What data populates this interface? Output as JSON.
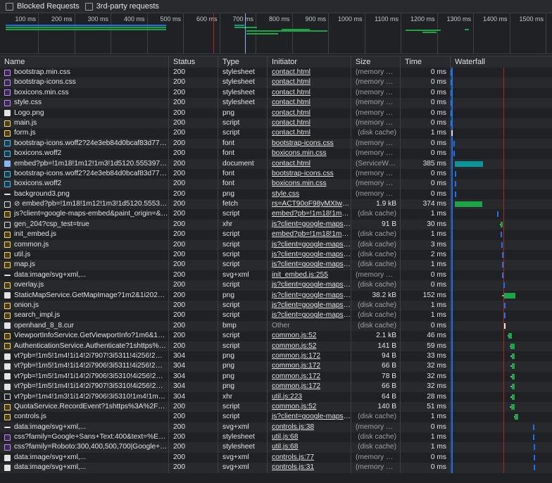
{
  "toolbar": {
    "blocked_requests": "Blocked Requests",
    "third_party": "3rd-party requests"
  },
  "overview": {
    "ticks": [
      "100 ms",
      "200 ms",
      "300 ms",
      "400 ms",
      "500 ms",
      "600 ms",
      "700 ms",
      "800 ms",
      "900 ms",
      "1000 ms",
      "1100 ms",
      "1200 ms",
      "1300 ms",
      "1400 ms",
      "1500 ms"
    ]
  },
  "columns": {
    "name": "Name",
    "status": "Status",
    "type": "Type",
    "initiator": "Initiator",
    "size": "Size",
    "time": "Time",
    "waterfall": "Waterfall"
  },
  "colors": {
    "bg": "#202124",
    "alt_row": "#28292c",
    "teal": "#0b9797",
    "green": "#1ea446",
    "blue_line": "#1a73e8",
    "red_line": "#b3261e"
  },
  "rows": [
    {
      "icon": "css-file-icon",
      "kind": "css",
      "name": "bootstrap.min.css",
      "status": "200",
      "type": "stylesheet",
      "initiator": "contact.html",
      "link": true,
      "size": "(memory cac...",
      "size_muted": true,
      "time": "0 ms",
      "wf_start": 0.3,
      "wf_len": 0.5,
      "wf_color": "#1a73e8",
      "wf_lead": 0
    },
    {
      "icon": "css-file-icon",
      "kind": "css",
      "name": "bootstrap-icons.css",
      "status": "200",
      "type": "stylesheet",
      "initiator": "contact.html",
      "link": true,
      "size": "(memory cac...",
      "size_muted": true,
      "time": "0 ms",
      "wf_start": 0.3,
      "wf_len": 0.5,
      "wf_color": "#1a73e8",
      "wf_lead": 0
    },
    {
      "icon": "css-file-icon",
      "kind": "css",
      "name": "boxicons.min.css",
      "status": "200",
      "type": "stylesheet",
      "initiator": "contact.html",
      "link": true,
      "size": "(memory cac...",
      "size_muted": true,
      "time": "0 ms",
      "wf_start": 0.3,
      "wf_len": 0.5,
      "wf_color": "#1a73e8",
      "wf_lead": 0
    },
    {
      "icon": "css-file-icon",
      "kind": "css",
      "name": "style.css",
      "status": "200",
      "type": "stylesheet",
      "initiator": "contact.html",
      "link": true,
      "size": "(memory cac...",
      "size_muted": true,
      "time": "0 ms",
      "wf_start": 0.3,
      "wf_len": 0.5,
      "wf_color": "#1a73e8",
      "wf_lead": 0
    },
    {
      "icon": "image-file-icon",
      "kind": "img",
      "name": "Logo.png",
      "status": "200",
      "type": "png",
      "initiator": "contact.html",
      "link": true,
      "size": "(memory cac...",
      "size_muted": true,
      "time": "0 ms",
      "wf_start": 0.3,
      "wf_len": 0.5,
      "wf_color": "#1a73e8",
      "wf_lead": 0
    },
    {
      "icon": "js-file-icon",
      "kind": "js",
      "name": "main.js",
      "status": "200",
      "type": "script",
      "initiator": "contact.html",
      "link": true,
      "size": "(memory cac...",
      "size_muted": true,
      "time": "0 ms",
      "wf_start": 0.3,
      "wf_len": 0.5,
      "wf_color": "#1a73e8",
      "wf_lead": 0
    },
    {
      "icon": "js-file-icon",
      "kind": "js",
      "name": "form.js",
      "status": "200",
      "type": "script",
      "initiator": "contact.html",
      "link": true,
      "size": "(disk cache)",
      "size_muted": true,
      "time": "1 ms",
      "wf_start": 0.5,
      "wf_len": 1.5,
      "wf_color": "#e3e3e3",
      "wf_lead": 0
    },
    {
      "icon": "font-file-icon",
      "kind": "font",
      "name": "bootstrap-icons.woff2?24e3eb84d0bcaf83d77f90...",
      "status": "200",
      "type": "font",
      "initiator": "bootstrap-icons.css",
      "link": true,
      "size": "(memory cac...",
      "size_muted": true,
      "time": "0 ms",
      "wf_start": 2.5,
      "wf_len": 0.5,
      "wf_color": "#1a73e8",
      "wf_lead": 0
    },
    {
      "icon": "font-file-icon",
      "kind": "font",
      "name": "boxicons.woff2",
      "status": "200",
      "type": "font",
      "initiator": "boxicons.min.css",
      "link": true,
      "size": "(memory cac...",
      "size_muted": true,
      "time": "0 ms",
      "wf_start": 2.5,
      "wf_len": 0.5,
      "wf_color": "#1a73e8",
      "wf_lead": 0
    },
    {
      "icon": "document-file-icon",
      "kind": "doc",
      "name": "embed?pb=!1m18!1m12!1m3!1d5120.555397400...",
      "status": "200",
      "type": "document",
      "initiator": "contact.html",
      "link": true,
      "size": "(ServiceWorker)",
      "size_muted": true,
      "time": "385 ms",
      "wf_start": 4.5,
      "wf_len": 27.5,
      "wf_color": "#0b9797",
      "wf_lead": 0
    },
    {
      "icon": "font-file-icon",
      "kind": "font",
      "name": "bootstrap-icons.woff2?24e3eb84d0bcaf83d77f90...",
      "status": "200",
      "type": "font",
      "initiator": "bootstrap-icons.css",
      "link": true,
      "size": "(memory cac...",
      "size_muted": true,
      "time": "0 ms",
      "wf_start": 4.0,
      "wf_len": 0.5,
      "wf_color": "#1a73e8",
      "wf_lead": 0
    },
    {
      "icon": "font-file-icon",
      "kind": "font",
      "name": "boxicons.woff2",
      "status": "200",
      "type": "font",
      "initiator": "boxicons.min.css",
      "link": true,
      "size": "(memory cac...",
      "size_muted": true,
      "time": "0 ms",
      "wf_start": 4.0,
      "wf_len": 0.5,
      "wf_color": "#1a73e8",
      "wf_lead": 0
    },
    {
      "icon": "image-file-icon",
      "kind": "dash",
      "name": "background3.png",
      "status": "200",
      "type": "png",
      "initiator": "style.css",
      "link": true,
      "size": "(memory cac...",
      "size_muted": true,
      "time": "0 ms",
      "wf_start": 4.0,
      "wf_len": 0.5,
      "wf_color": "#1a73e8",
      "wf_lead": 0
    },
    {
      "icon": "fetch-file-icon",
      "kind": "xhr",
      "name": "⊘ embed?pb=!1m18!1m12!1m3!1d5120.5553974...",
      "status": "200",
      "type": "fetch",
      "initiator": "rs=ACT90oF98yMXIwkm...",
      "link": true,
      "size": "1.9 kB",
      "size_muted": false,
      "time": "374 ms",
      "wf_start": 4.5,
      "wf_len": 26.8,
      "wf_color": "#1ea446",
      "wf_lead": 0
    },
    {
      "icon": "js-file-icon",
      "kind": "js",
      "name": "js?client=google-maps-embed&paint_origin=&li...",
      "status": "200",
      "type": "script",
      "initiator": "embed?pb=!1m18!1m12...",
      "link": true,
      "size": "(disk cache)",
      "size_muted": true,
      "time": "1 ms",
      "wf_start": 45.5,
      "wf_len": 1.0,
      "wf_color": "#1a73e8",
      "wf_lead": 0
    },
    {
      "icon": "xhr-file-icon",
      "kind": "xhr",
      "name": "gen_204?csp_test=true",
      "status": "200",
      "type": "xhr",
      "initiator": "js?client=google-maps-e...",
      "link": true,
      "size": "91 B",
      "size_muted": false,
      "time": "30 ms",
      "wf_start": 49.5,
      "wf_len": 2.0,
      "wf_color": "#1ea446",
      "wf_lead": 1.0
    },
    {
      "icon": "js-file-icon",
      "kind": "js",
      "name": "init_embed.js",
      "status": "200",
      "type": "script",
      "initiator": "embed?pb=!1m18!1m12...",
      "link": true,
      "size": "(disk cache)",
      "size_muted": true,
      "time": "1 ms",
      "wf_start": 49.5,
      "wf_len": 1.0,
      "wf_color": "#1a73e8",
      "wf_lead": 0
    },
    {
      "icon": "js-file-icon",
      "kind": "js",
      "name": "common.js",
      "status": "200",
      "type": "script",
      "initiator": "js?client=google-maps-e...",
      "link": true,
      "size": "(disk cache)",
      "size_muted": true,
      "time": "3 ms",
      "wf_start": 50.0,
      "wf_len": 1.0,
      "wf_color": "#1a73e8",
      "wf_lead": 0
    },
    {
      "icon": "js-file-icon",
      "kind": "js",
      "name": "util.js",
      "status": "200",
      "type": "script",
      "initiator": "js?client=google-maps-e...",
      "link": true,
      "size": "(disk cache)",
      "size_muted": true,
      "time": "2 ms",
      "wf_start": 50.5,
      "wf_len": 1.0,
      "wf_color": "#1a73e8",
      "wf_lead": 0
    },
    {
      "icon": "js-file-icon",
      "kind": "js",
      "name": "map.js",
      "status": "200",
      "type": "script",
      "initiator": "js?client=google-maps-e...",
      "link": true,
      "size": "(disk cache)",
      "size_muted": true,
      "time": "1 ms",
      "wf_start": 51.0,
      "wf_len": 1.0,
      "wf_color": "#1a73e8",
      "wf_lead": 0
    },
    {
      "icon": "svg-image-icon",
      "kind": "dash",
      "name": "data:image/svg+xml,...",
      "status": "200",
      "type": "svg+xml",
      "initiator": "init_embed.js:255",
      "link": true,
      "size": "(memory cac...",
      "size_muted": true,
      "time": "0 ms",
      "wf_start": 51.0,
      "wf_len": 0.5,
      "wf_color": "#1a73e8",
      "wf_lead": 0
    },
    {
      "icon": "js-file-icon",
      "kind": "js",
      "name": "overlay.js",
      "status": "200",
      "type": "script",
      "initiator": "js?client=google-maps-e...",
      "link": true,
      "size": "(disk cache)",
      "size_muted": true,
      "time": "0 ms",
      "wf_start": 52.0,
      "wf_len": 0.8,
      "wf_color": "#1a73e8",
      "wf_lead": 0
    },
    {
      "icon": "image-file-icon",
      "kind": "img",
      "name": "StaticMapService.GetMapImage?1m2&1i2024011...",
      "status": "200",
      "type": "png",
      "initiator": "js?client=google-maps-e...",
      "link": true,
      "size": "38.2 kB",
      "size_muted": false,
      "time": "152 ms",
      "wf_start": 53.0,
      "wf_len": 11.0,
      "wf_color": "#1ea446",
      "wf_lead": 2.0
    },
    {
      "icon": "js-file-icon",
      "kind": "js",
      "name": "onion.js",
      "status": "200",
      "type": "script",
      "initiator": "js?client=google-maps-e...",
      "link": true,
      "size": "(disk cache)",
      "size_muted": true,
      "time": "1 ms",
      "wf_start": 52.5,
      "wf_len": 0.8,
      "wf_color": "#1a73e8",
      "wf_lead": 0
    },
    {
      "icon": "js-file-icon",
      "kind": "js",
      "name": "search_impl.js",
      "status": "200",
      "type": "script",
      "initiator": "js?client=google-maps-e...",
      "link": true,
      "size": "(disk cache)",
      "size_muted": true,
      "time": "1 ms",
      "wf_start": 52.5,
      "wf_len": 0.8,
      "wf_color": "#1a73e8",
      "wf_lead": 0
    },
    {
      "icon": "image-file-icon",
      "kind": "img",
      "name": "openhand_8_8.cur",
      "status": "200",
      "type": "bmp",
      "initiator": "Other",
      "link": false,
      "size": "(disk cache)",
      "size_muted": true,
      "time": "0 ms",
      "wf_start": 53.0,
      "wf_len": 1.0,
      "wf_color": "#e3e3e3",
      "wf_lead": 0
    },
    {
      "icon": "js-file-icon",
      "kind": "js",
      "name": "ViewportInfoService.GetViewportInfo?1m6&1m2...",
      "status": "200",
      "type": "script",
      "initiator": "common.js:52",
      "link": true,
      "size": "2.1 kB",
      "size_muted": false,
      "time": "46 ms",
      "wf_start": 57.0,
      "wf_len": 3.5,
      "wf_color": "#1ea446",
      "wf_lead": 1.0
    },
    {
      "icon": "js-file-icon",
      "kind": "js",
      "name": "AuthenticationService.Authenticate?1shttps%3A%...",
      "status": "200",
      "type": "script",
      "initiator": "common.js:52",
      "link": true,
      "size": "141 B",
      "size_muted": false,
      "time": "59 ms",
      "wf_start": 59.0,
      "wf_len": 4.0,
      "wf_color": "#1ea446",
      "wf_lead": 1.0
    },
    {
      "icon": "image-file-icon",
      "kind": "img",
      "name": "vt?pb=!1m5!1m4!1i14!2i7907!3i5311!4i256!2m3!1...",
      "status": "304",
      "type": "png",
      "initiator": "common.js:172",
      "link": true,
      "size": "94 B",
      "size_muted": false,
      "time": "33 ms",
      "wf_start": 60.5,
      "wf_len": 3.0,
      "wf_color": "#1ea446",
      "wf_lead": 1.5
    },
    {
      "icon": "image-file-icon",
      "kind": "img",
      "name": "vt?pb=!1m5!1m4!1i14!2i7906!3i5311!4i256!2m3!1...",
      "status": "304",
      "type": "png",
      "initiator": "common.js:172",
      "link": true,
      "size": "66 B",
      "size_muted": false,
      "time": "32 ms",
      "wf_start": 60.5,
      "wf_len": 3.0,
      "wf_color": "#1ea446",
      "wf_lead": 1.5
    },
    {
      "icon": "image-file-icon",
      "kind": "img",
      "name": "vt?pb=!1m5!1m4!1i14!2i7906!3i5310!4i256!2m3!1...",
      "status": "304",
      "type": "png",
      "initiator": "common.js:172",
      "link": true,
      "size": "78 B",
      "size_muted": false,
      "time": "32 ms",
      "wf_start": 60.5,
      "wf_len": 3.0,
      "wf_color": "#1ea446",
      "wf_lead": 1.5
    },
    {
      "icon": "image-file-icon",
      "kind": "img",
      "name": "vt?pb=!1m5!1m4!1i14!2i7907!3i5310!4i256!2m3!1...",
      "status": "304",
      "type": "png",
      "initiator": "common.js:172",
      "link": true,
      "size": "66 B",
      "size_muted": false,
      "time": "32 ms",
      "wf_start": 60.5,
      "wf_len": 3.0,
      "wf_color": "#1ea446",
      "wf_lead": 1.5
    },
    {
      "icon": "xhr-file-icon",
      "kind": "xhr",
      "name": "vt?pb=!1m4!1m3!1i14!2i7906!3i5310!1m4!1m3!1i...",
      "status": "304",
      "type": "xhr",
      "initiator": "util.js:223",
      "link": true,
      "size": "64 B",
      "size_muted": false,
      "time": "28 ms",
      "wf_start": 60.5,
      "wf_len": 2.5,
      "wf_color": "#1ea446",
      "wf_lead": 1.5
    },
    {
      "icon": "js-file-icon",
      "kind": "js",
      "name": "QuotaService.RecordEvent?1shttps%3A%2F%2Fw...",
      "status": "200",
      "type": "script",
      "initiator": "common.js:52",
      "link": true,
      "size": "140 B",
      "size_muted": false,
      "time": "51 ms",
      "wf_start": 60.0,
      "wf_len": 3.5,
      "wf_color": "#1ea446",
      "wf_lead": 1.5
    },
    {
      "icon": "js-file-icon",
      "kind": "js",
      "name": "controls.js",
      "status": "200",
      "type": "script",
      "initiator": "js?client=google-maps-e...",
      "link": true,
      "size": "(disk cache)",
      "size_muted": true,
      "time": "1 ms",
      "wf_start": 63.5,
      "wf_len": 3.5,
      "wf_color": "#1ea446",
      "wf_lead": 1.0
    },
    {
      "icon": "svg-image-icon",
      "kind": "dash",
      "name": "data:image/svg+xml,...",
      "status": "200",
      "type": "svg+xml",
      "initiator": "controls.js:38",
      "link": true,
      "size": "(memory cac...",
      "size_muted": true,
      "time": "0 ms",
      "wf_start": 81.5,
      "wf_len": 0.8,
      "wf_color": "#1a73e8",
      "wf_lead": 0
    },
    {
      "icon": "css-file-icon",
      "kind": "css",
      "name": "css?family=Google+Sans+Text:400&text=%E2%8...",
      "status": "200",
      "type": "stylesheet",
      "initiator": "util.js:68",
      "link": true,
      "size": "(disk cache)",
      "size_muted": true,
      "time": "1 ms",
      "wf_start": 81.5,
      "wf_len": 0.8,
      "wf_color": "#1a73e8",
      "wf_lead": 0
    },
    {
      "icon": "css-file-icon",
      "kind": "css",
      "name": "css?family=Roboto:300,400,500,700|Google+Sans:...",
      "status": "200",
      "type": "stylesheet",
      "initiator": "util.js:68",
      "link": true,
      "size": "(disk cache)",
      "size_muted": true,
      "time": "1 ms",
      "wf_start": 82.0,
      "wf_len": 0.8,
      "wf_color": "#1a73e8",
      "wf_lead": 0
    },
    {
      "icon": "svg-image-icon",
      "kind": "img",
      "name": "data:image/svg+xml,...",
      "status": "200",
      "type": "svg+xml",
      "initiator": "controls.js:77",
      "link": true,
      "size": "(memory cac...",
      "size_muted": true,
      "time": "0 ms",
      "wf_start": 82.0,
      "wf_len": 0.8,
      "wf_color": "#1a73e8",
      "wf_lead": 0
    },
    {
      "icon": "svg-image-icon",
      "kind": "img",
      "name": "data:image/svg+xml,...",
      "status": "200",
      "type": "svg+xml",
      "initiator": "controls.js:31",
      "link": true,
      "size": "(memory cac...",
      "size_muted": true,
      "time": "0 ms",
      "wf_start": 82.0,
      "wf_len": 0.8,
      "wf_color": "#1a73e8",
      "wf_lead": 0
    }
  ]
}
